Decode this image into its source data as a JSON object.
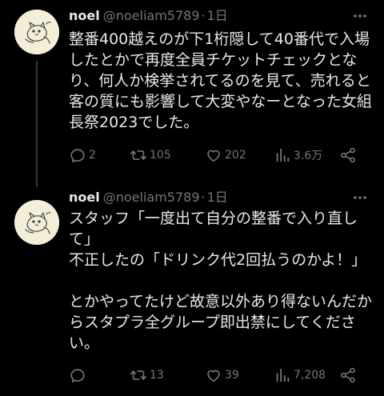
{
  "tweets": [
    {
      "author": {
        "name": "noel",
        "handle": "@noeliam5789"
      },
      "separator": "·",
      "time": "1日",
      "text": "整番400越えのが下1桁隠して40番代で入場したとかで再度全員チケットチェックとなり、何人か検挙されてるのを見て、売れると客の質にも影響して大変やなーとなった女組長祭2023でした。",
      "stats": {
        "replies": "2",
        "retweets": "105",
        "likes": "202",
        "views": "3.6万"
      },
      "icons": {
        "avatar": "cat-doodle-avatar-icon",
        "more": "more-horizontal-icon",
        "reply": "reply-icon",
        "retweet": "retweet-icon",
        "like": "heart-icon",
        "views": "views-bar-icon",
        "share": "share-icon"
      }
    },
    {
      "author": {
        "name": "noel",
        "handle": "@noeliam5789"
      },
      "separator": "·",
      "time": "1日",
      "text": "スタッフ「一度出て自分の整番で入り直して」\n不正したの「ドリンク代2回払うのかよ！」\n\nとかやってたけど故意以外あり得ないんだからスタプラ全グループ即出禁にしてください。",
      "stats": {
        "replies": "",
        "retweets": "13",
        "likes": "39",
        "views": "7,208"
      },
      "icons": {
        "avatar": "cat-doodle-avatar-icon",
        "more": "more-horizontal-icon",
        "reply": "reply-icon",
        "retweet": "retweet-icon",
        "like": "heart-icon",
        "views": "views-bar-icon",
        "share": "share-icon"
      }
    }
  ],
  "colors": {
    "background": "#000000",
    "text_primary": "#e7e9ea",
    "text_secondary": "#71767b",
    "thread_line": "#333639",
    "avatar_bg": "#f3eed7"
  }
}
